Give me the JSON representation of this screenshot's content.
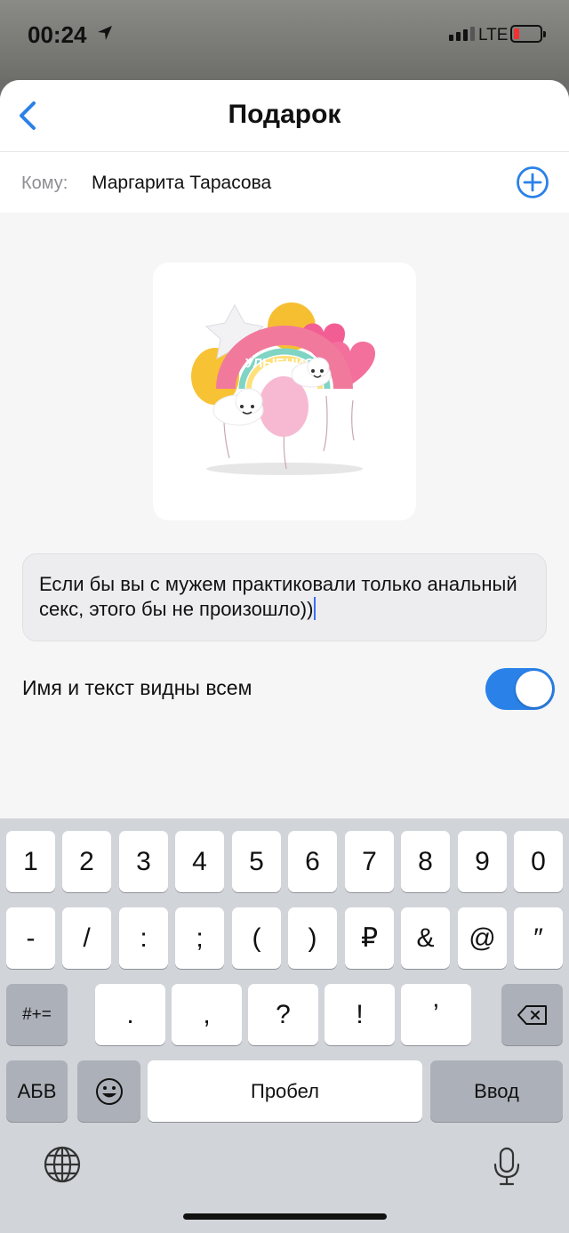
{
  "status_bar": {
    "time": "00:24",
    "network": "LTE",
    "icons": [
      "location-arrow-icon",
      "signal-icon",
      "battery-icon"
    ],
    "battery_level": 0.12
  },
  "header": {
    "title": "Подарок",
    "back_icon": "chevron-left-icon"
  },
  "recipient": {
    "label": "Кому:",
    "name": "Маргарита Тарасова",
    "add_icon": "plus-circle-icon"
  },
  "gift": {
    "image": "balloon-bouquet",
    "banner_text": "УЛЫБНИСЬ"
  },
  "message": {
    "text": "Если бы вы с мужем практиковали только анальный секс, этого бы не произошло))"
  },
  "visibility": {
    "label": "Имя и текст видны всем",
    "enabled": true
  },
  "keyboard": {
    "row1": [
      "1",
      "2",
      "3",
      "4",
      "5",
      "6",
      "7",
      "8",
      "9",
      "0"
    ],
    "row2": [
      "-",
      "/",
      ":",
      ";",
      "(",
      ")",
      "₽",
      "&",
      "@",
      "″"
    ],
    "row3": [
      ".",
      ",",
      "?",
      "!",
      "ʼ"
    ],
    "symbols_key": "#+=",
    "alpha_key": "АБВ",
    "space": "Пробел",
    "enter": "Ввод",
    "icons": [
      "backspace-icon",
      "emoji-icon",
      "globe-icon",
      "microphone-icon"
    ]
  },
  "colors": {
    "accent": "#2a81e8",
    "keyboard_bg": "#d1d4d9",
    "function_key": "#acb0b8"
  }
}
